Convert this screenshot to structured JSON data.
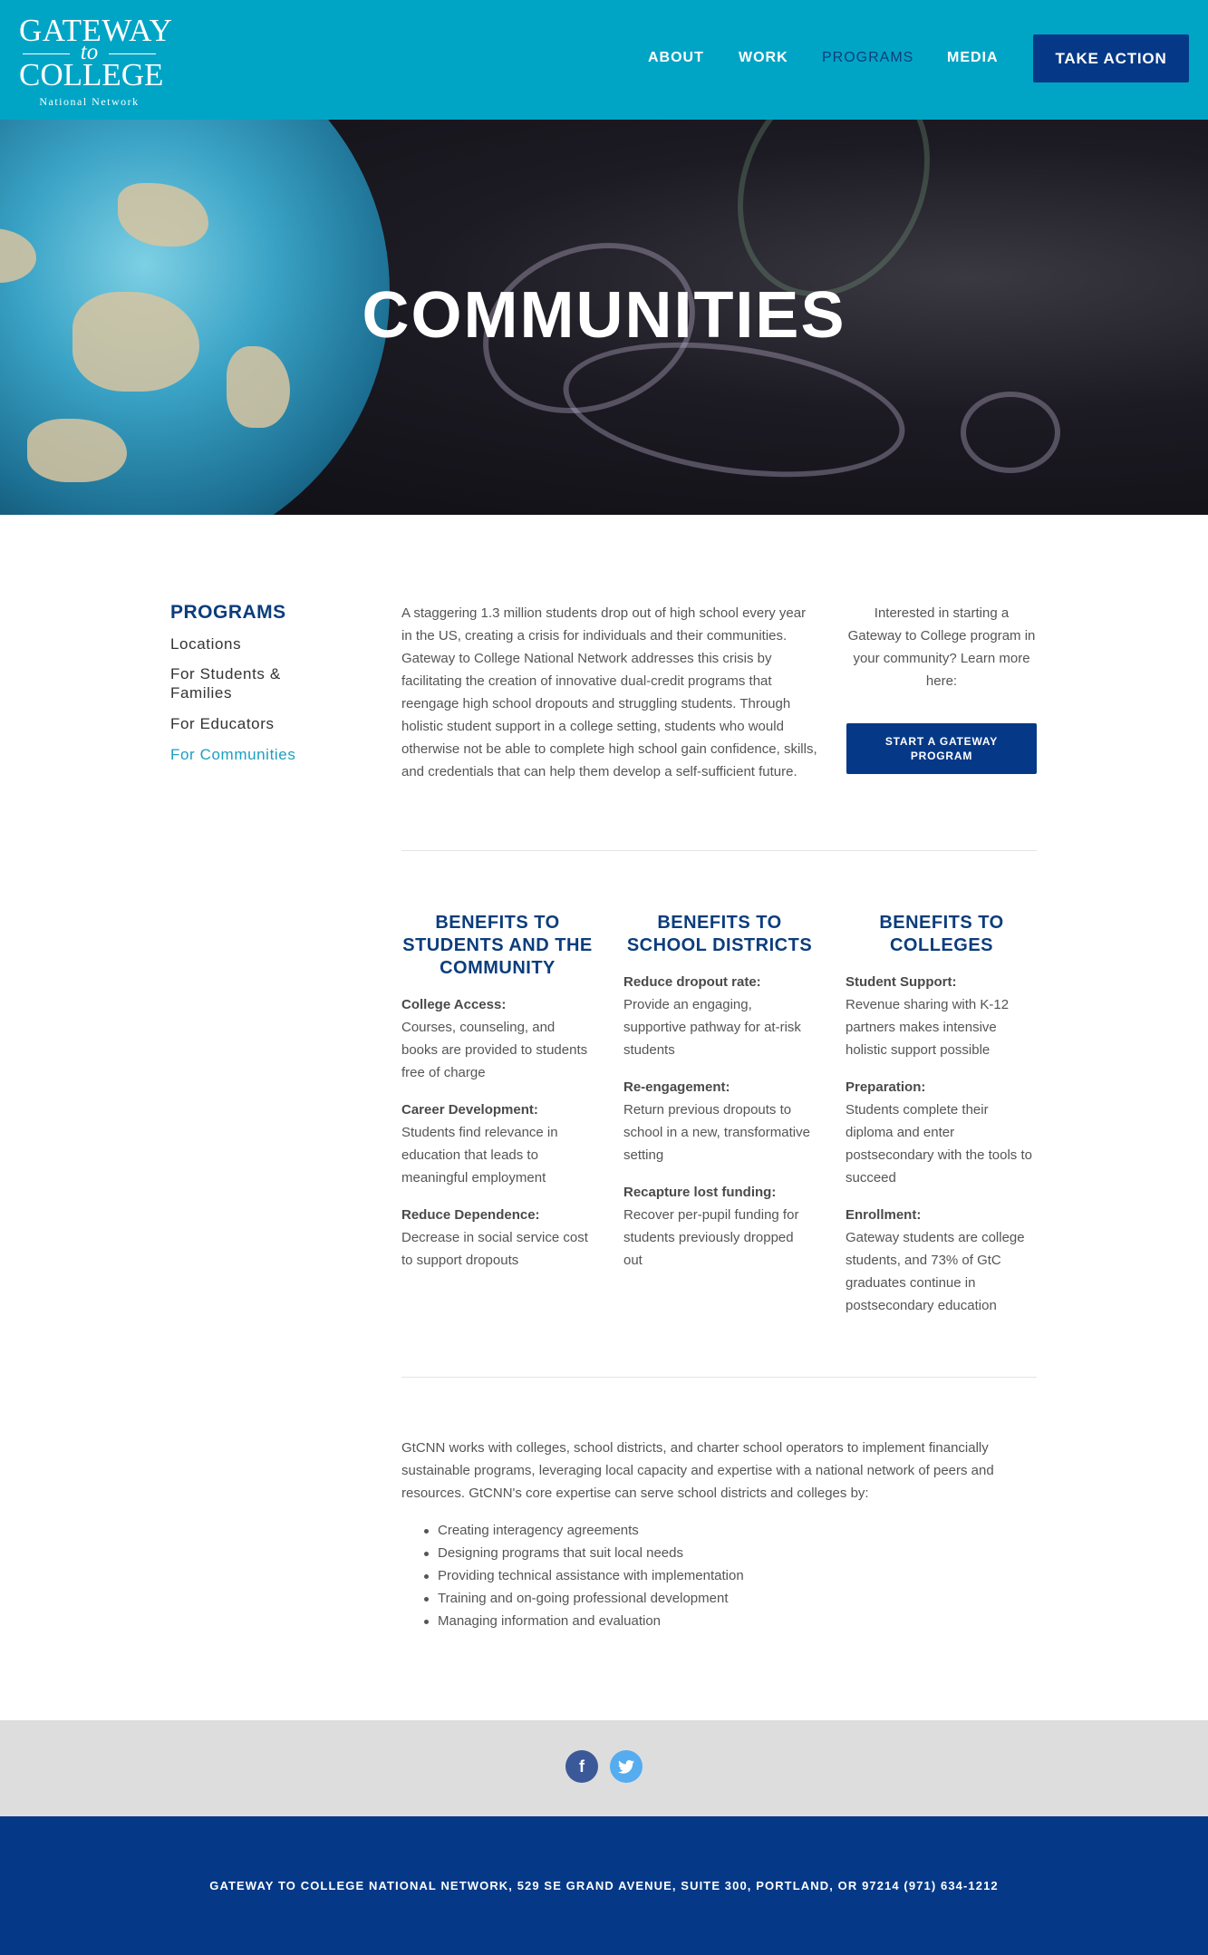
{
  "header": {
    "logo": {
      "line1": "GATEWAY",
      "line2": "to",
      "line3": "COLLEGE",
      "line4": "National Network"
    },
    "nav": [
      {
        "label": "ABOUT"
      },
      {
        "label": "WORK"
      },
      {
        "label": "PROGRAMS",
        "active": true
      },
      {
        "label": "MEDIA"
      }
    ],
    "cta_label": "TAKE ACTION"
  },
  "hero": {
    "title": "COMMUNITIES"
  },
  "sidebar": {
    "title": "PROGRAMS",
    "items": [
      {
        "label": "Locations"
      },
      {
        "label": "For Students & Families"
      },
      {
        "label": "For Educators"
      },
      {
        "label": "For Communities",
        "active": true
      }
    ]
  },
  "intro": {
    "text": "A staggering 1.3 million students drop out of high school every year in the US, creating a crisis for individuals and their communities. Gateway to College National Network addresses this crisis by facilitating the creation of innovative dual-credit programs that reengage high school dropouts and struggling students. Through holistic student support in a college setting, students who would otherwise not be able to complete high school gain confidence, skills, and credentials that can help them develop a self-sufficient future."
  },
  "aside": {
    "text": "Interested in starting a Gateway to College program in your community? Learn more here:",
    "button_label": "START A GATEWAY PROGRAM"
  },
  "benefits": [
    {
      "title": "BENEFITS TO STUDENTS AND THE COMMUNITY",
      "items": [
        {
          "heading": "College Access:",
          "text": "Courses, counseling, and books are provided to students free of charge"
        },
        {
          "heading": "Career Development:",
          "text": "Students find relevance in education that leads to meaningful employment"
        },
        {
          "heading": "Reduce Dependence:",
          "text": "Decrease in social service cost to support dropouts"
        }
      ]
    },
    {
      "title": "BENEFITS TO SCHOOL DISTRICTS",
      "items": [
        {
          "heading": "Reduce dropout rate:",
          "text": "Provide an engaging, supportive pathway for at-risk students"
        },
        {
          "heading": "Re-engagement:",
          "text": "Return previous dropouts to school in a new, transformative setting"
        },
        {
          "heading": "Recapture lost funding:",
          "text": "Recover per-pupil funding for students previously dropped out"
        }
      ]
    },
    {
      "title": "BENEFITS TO COLLEGES",
      "items": [
        {
          "heading": "Student Support:",
          "text": "Revenue sharing with K-12 partners makes intensive holistic support possible"
        },
        {
          "heading": "Preparation:",
          "text": "Students complete their diploma and enter postsecondary with the tools to succeed"
        },
        {
          "heading": "Enrollment:",
          "text": "Gateway students are college students, and 73% of GtC graduates continue in postsecondary education"
        }
      ]
    }
  ],
  "closing": {
    "text": "GtCNN works with colleges, school districts, and charter school operators to implement financially sustainable programs, leveraging local capacity and expertise with a national network of peers and resources. GtCNN's core expertise can serve school districts and colleges by:",
    "bullets": [
      "Creating interagency agreements",
      "Designing programs that suit local needs",
      "Providing technical assistance with implementation",
      "Training and on-going professional development",
      "Managing information and evaluation"
    ]
  },
  "social": [
    {
      "icon": "facebook-icon",
      "glyph": "f"
    },
    {
      "icon": "twitter-icon",
      "glyph": "t"
    }
  ],
  "footer": {
    "address": "GATEWAY TO COLLEGE NATIONAL NETWORK, 529 SE GRAND AVENUE, SUITE 300, PORTLAND, OR 97214   (971) 634-1212"
  },
  "colors": {
    "header_bg": "#00a5c6",
    "brand_navy": "#053987",
    "active_link": "#1b9fc0",
    "social_bar_bg": "#dddddd"
  }
}
